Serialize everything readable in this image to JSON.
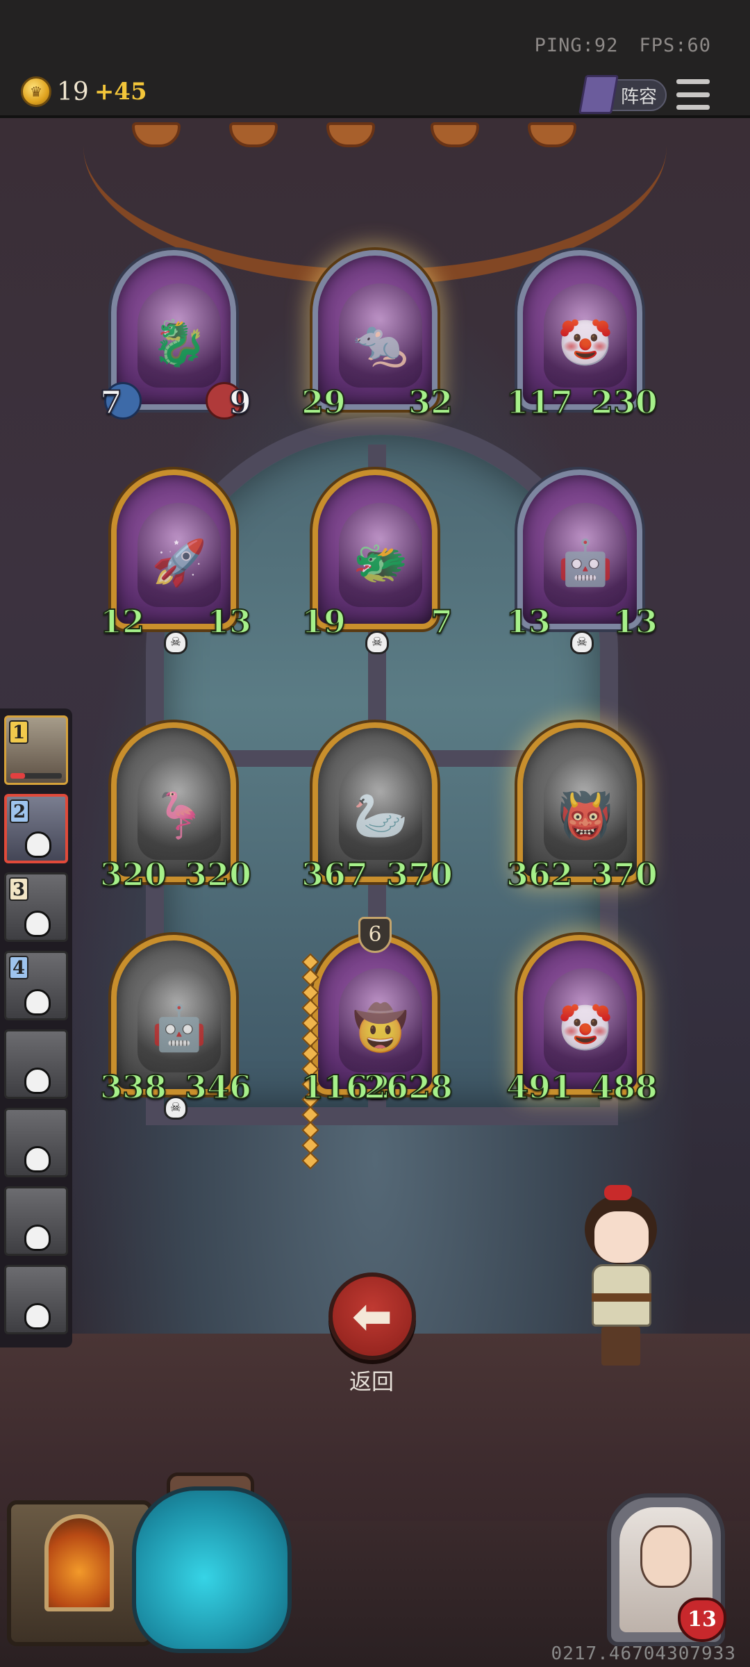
{
  "topbar": {
    "ping": "PING:92",
    "fps": "FPS:60",
    "coins": "19",
    "coin_bonus": "+45",
    "lineup_label": "阵容"
  },
  "board": {
    "rows": [
      [
        {
          "attack": "7",
          "health": "9",
          "style": "silver",
          "stat_style": "white"
        },
        {
          "attack": "29",
          "health": "32",
          "style": "silver",
          "stat_style": "green"
        },
        {
          "attack": "117",
          "health": "230",
          "style": "silver",
          "stat_style": "green"
        }
      ],
      [
        {
          "attack": "12",
          "health": "13",
          "style": "gold",
          "stat_style": "green"
        },
        {
          "attack": "19",
          "health": "7",
          "style": "gold",
          "stat_style": "green"
        },
        {
          "attack": "13",
          "health": "13",
          "style": "silver",
          "stat_style": "green"
        }
      ],
      [
        {
          "attack": "320",
          "health": "320",
          "style": "gold",
          "stat_style": "green"
        },
        {
          "attack": "367",
          "health": "370",
          "style": "gold",
          "stat_style": "green"
        },
        {
          "attack": "362",
          "health": "370",
          "style": "gold",
          "stat_style": "green"
        }
      ],
      [
        {
          "attack": "338",
          "health": "346",
          "style": "gold",
          "stat_style": "green"
        },
        {
          "attack": "1162",
          "health": "2628",
          "style": "gold",
          "stat_style": "green",
          "level": "6"
        },
        {
          "attack": "491",
          "health": "488",
          "style": "gold",
          "stat_style": "green"
        }
      ]
    ]
  },
  "roster": {
    "items": [
      {
        "rank": "1"
      },
      {
        "rank": "2"
      },
      {
        "rank": "3"
      },
      {
        "rank": "4"
      },
      {
        "rank": ""
      },
      {
        "rank": ""
      },
      {
        "rank": ""
      },
      {
        "rank": ""
      }
    ]
  },
  "controls": {
    "back_label": "返回",
    "back_icon": "arrow-left-icon"
  },
  "player": {
    "health": "13"
  },
  "footer": {
    "id_text": "0217.46704307933"
  },
  "colors": {
    "stat_green": "#a6f08a",
    "gold_frame": "#c98f2c",
    "silver_frame": "#7d86a0",
    "back_button": "#c03a32"
  }
}
